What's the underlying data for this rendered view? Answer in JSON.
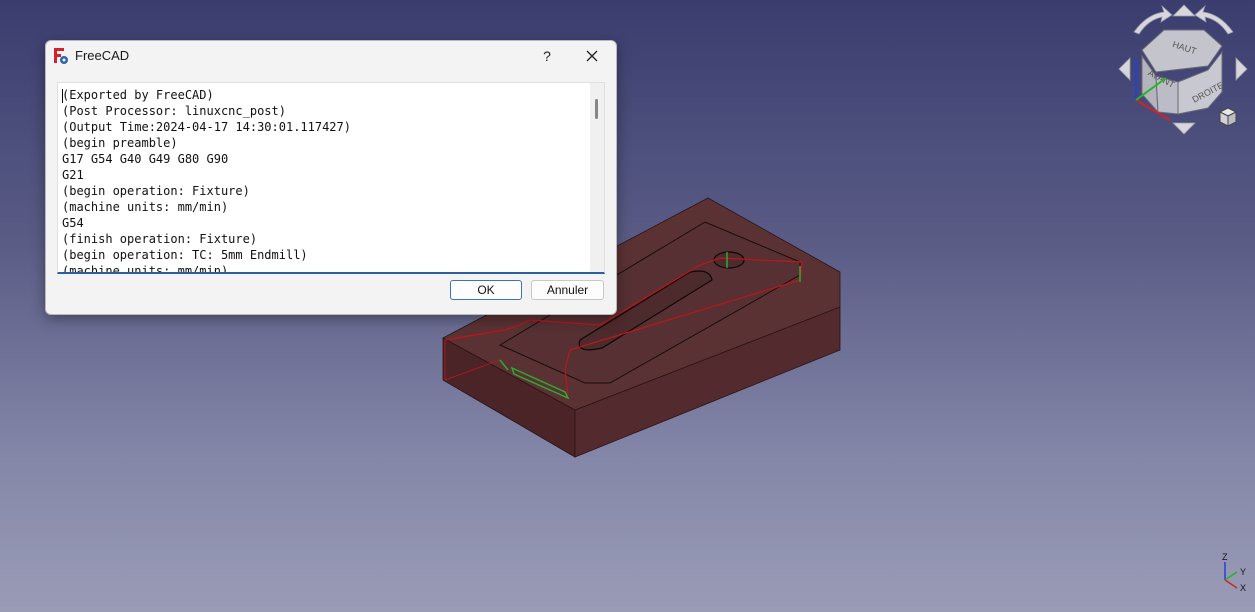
{
  "dialog": {
    "title": "FreeCAD",
    "help_label": "?",
    "ok_label": "OK",
    "cancel_label": "Annuler",
    "code_lines": [
      "(Exported by FreeCAD)",
      "(Post Processor: linuxcnc_post)",
      "(Output Time:2024-04-17 14:30:01.117427)",
      "(begin preamble)",
      "G17 G54 G40 G49 G80 G90",
      "G21",
      "(begin operation: Fixture)",
      "(machine units: mm/min)",
      "G54",
      "(finish operation: Fixture)",
      "(begin operation: TC: 5mm Endmill)",
      "(machine units: mm/min)"
    ]
  },
  "navcube": {
    "top_label": "HAUT",
    "front_label": "AVANT",
    "right_label": "DROITE"
  },
  "axis": {
    "x_label": "X",
    "y_label": "Y",
    "z_label": "Z"
  },
  "colors": {
    "model": "#4b2a2c",
    "toolpath": "#c0141c",
    "rapid": "#2ea82e",
    "accent": "#3b73b9"
  }
}
